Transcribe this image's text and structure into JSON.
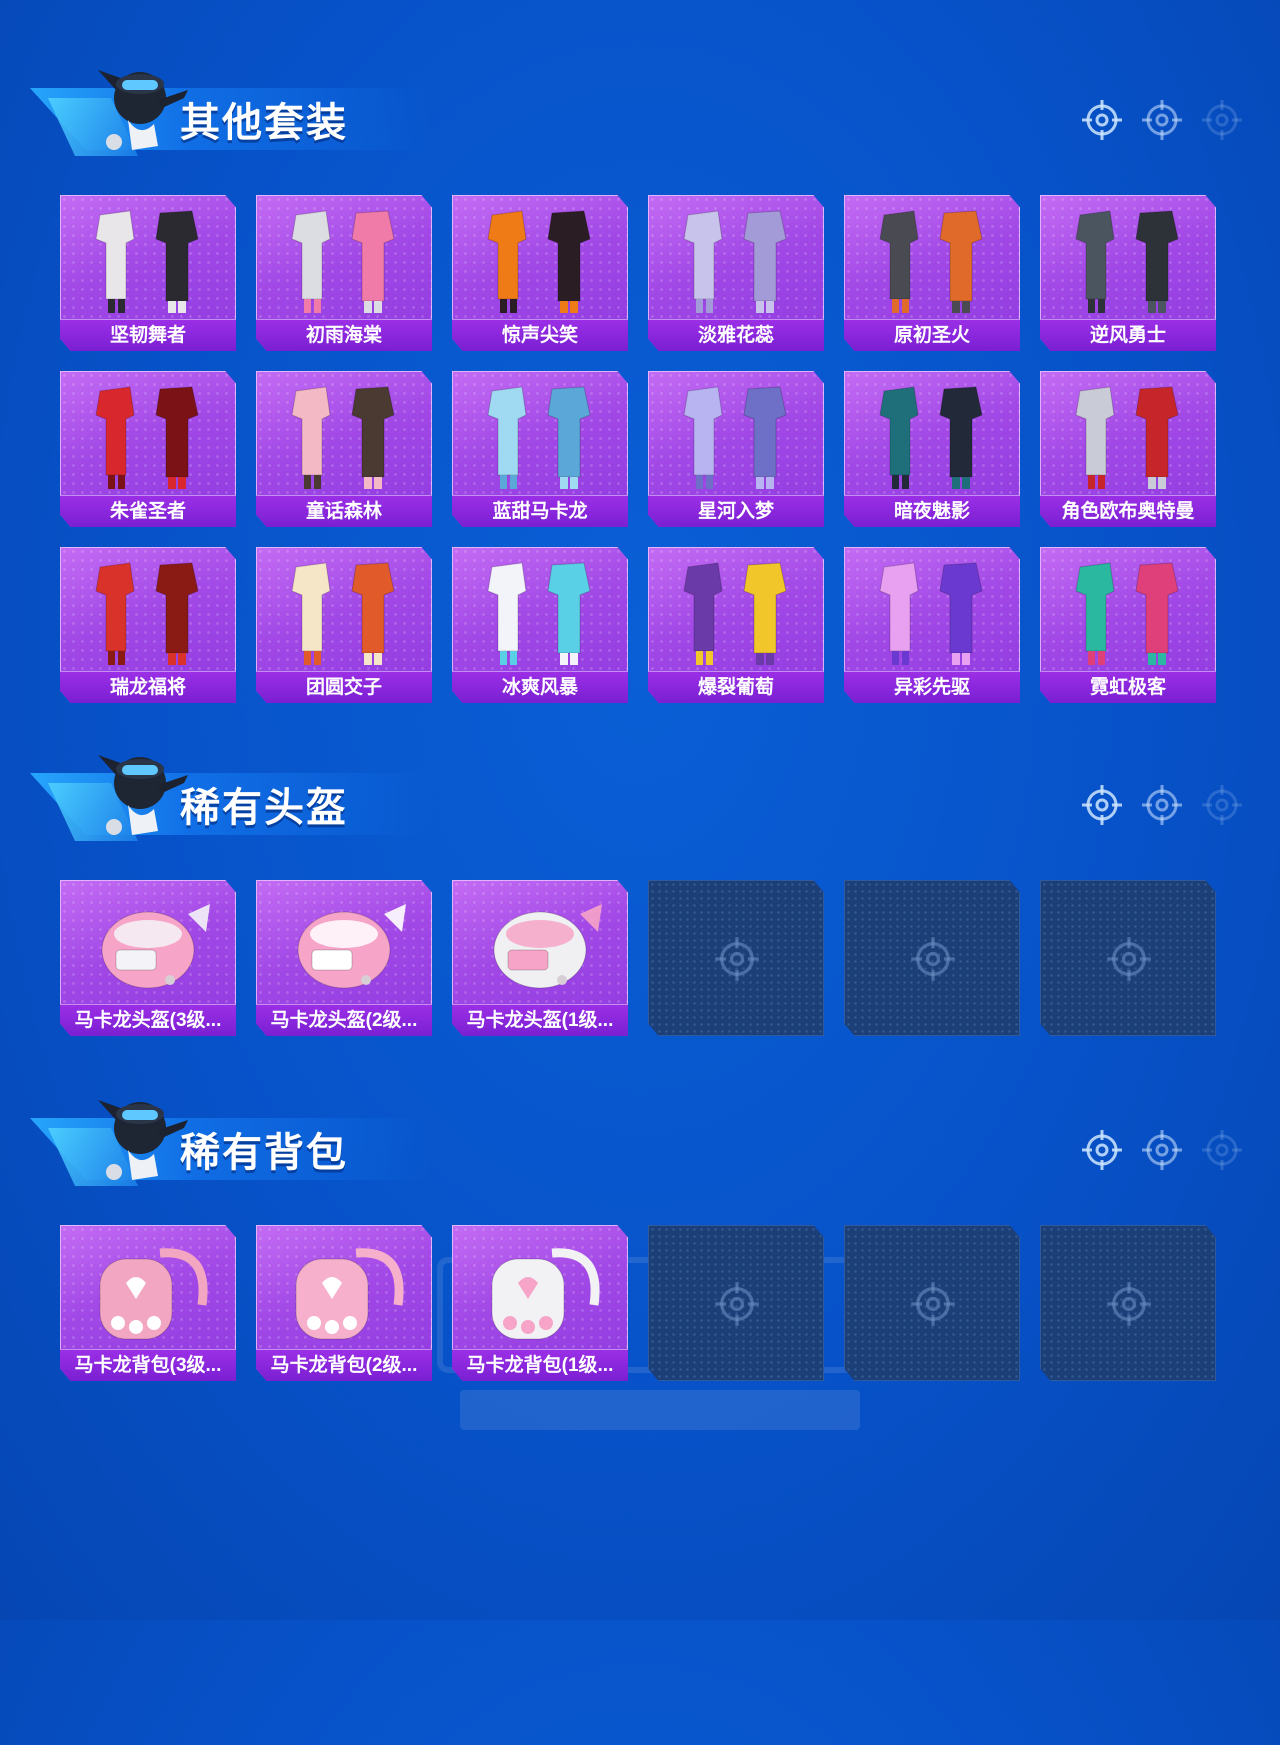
{
  "sections": [
    {
      "title": "其他套装",
      "items": [
        {
          "label": "坚韧舞者",
          "palette": [
            "#e9e6ea",
            "#2a2a30"
          ]
        },
        {
          "label": "初雨海棠",
          "palette": [
            "#dcdde3",
            "#f07aa8"
          ]
        },
        {
          "label": "惊声尖笑",
          "palette": [
            "#ef7b16",
            "#2a1e24"
          ]
        },
        {
          "label": "淡雅花蕊",
          "palette": [
            "#c7c3ea",
            "#a39bd8"
          ]
        },
        {
          "label": "原初圣火",
          "palette": [
            "#4a4a52",
            "#e06a2a"
          ]
        },
        {
          "label": "逆风勇士",
          "palette": [
            "#4b5560",
            "#2d3238"
          ]
        },
        {
          "label": "朱雀圣者",
          "palette": [
            "#d8282e",
            "#7a1216"
          ]
        },
        {
          "label": "童话森林",
          "palette": [
            "#f3b9c4",
            "#4a3a32"
          ]
        },
        {
          "label": "蓝甜马卡龙",
          "palette": [
            "#9fd9f2",
            "#5aa7d8"
          ]
        },
        {
          "label": "星河入梦",
          "palette": [
            "#b8b4f2",
            "#6e70c8"
          ]
        },
        {
          "label": "暗夜魅影",
          "palette": [
            "#1f6f7a",
            "#222a3a"
          ]
        },
        {
          "label": "角色欧布奥特曼",
          "palette": [
            "#c9ccd6",
            "#c6262a"
          ]
        },
        {
          "label": "瑞龙福将",
          "palette": [
            "#d8322a",
            "#8a1a14"
          ]
        },
        {
          "label": "团圆交子",
          "palette": [
            "#f6e6c8",
            "#e05a2a"
          ]
        },
        {
          "label": "冰爽风暴",
          "palette": [
            "#f2f4fa",
            "#5ad0e6"
          ]
        },
        {
          "label": "爆裂葡萄",
          "palette": [
            "#6a3aa8",
            "#f0c62a"
          ]
        },
        {
          "label": "异彩先驱",
          "palette": [
            "#e8a0f0",
            "#6a3ad0"
          ]
        },
        {
          "label": "霓虹极客",
          "palette": [
            "#2ab8a0",
            "#e0407a"
          ]
        }
      ]
    },
    {
      "title": "稀有头盔",
      "items": [
        {
          "label": "马卡龙头盔(3级...",
          "palette": [
            "#f6a4c8",
            "#f4f4f8"
          ]
        },
        {
          "label": "马卡龙头盔(2级...",
          "palette": [
            "#f6a4c8",
            "#ffffff"
          ]
        },
        {
          "label": "马卡龙头盔(1级...",
          "palette": [
            "#f0f0f2",
            "#f6a4c8"
          ]
        },
        {
          "label": "",
          "empty": true
        },
        {
          "label": "",
          "empty": true
        },
        {
          "label": "",
          "empty": true
        }
      ]
    },
    {
      "title": "稀有背包",
      "items": [
        {
          "label": "马卡龙背包(3级...",
          "palette": [
            "#f3a6c2",
            "#ffffff"
          ]
        },
        {
          "label": "马卡龙背包(2级...",
          "palette": [
            "#f6b0cc",
            "#ffffff"
          ]
        },
        {
          "label": "马卡龙背包(1级...",
          "palette": [
            "#f2f2f4",
            "#f6a4c8"
          ]
        },
        {
          "label": "",
          "empty": true
        },
        {
          "label": "",
          "empty": true
        },
        {
          "label": "",
          "empty": true
        }
      ]
    }
  ],
  "icons": {
    "reticle": "crosshair-icon",
    "empty_slot": "crosshair-icon"
  },
  "colors": {
    "background": "#0752c9",
    "card_purple": "#a148e6",
    "label_purple": "#7a1fd2",
    "empty_slot": "#1d3f78"
  }
}
